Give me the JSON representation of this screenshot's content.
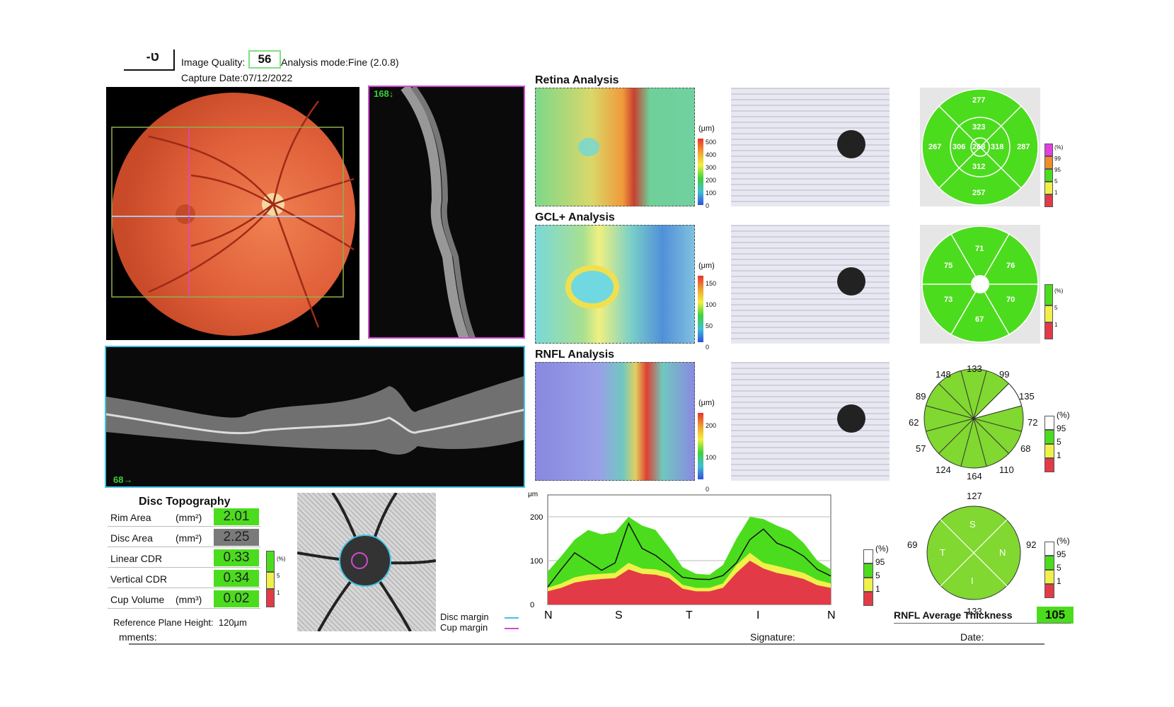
{
  "header": {
    "logo_fragment": "-ט",
    "image_quality_label": "Image Quality:",
    "image_quality_value": "56",
    "analysis_mode": "Analysis mode:Fine (2.0.8)",
    "capture_date": "Capture Date:07/12/2022"
  },
  "scans": {
    "vertical_oct_label": "168↓",
    "horizontal_oct_label": "68→"
  },
  "analysis": {
    "retina_title": "Retina Analysis",
    "gcl_title": "GCL+ Analysis",
    "rnfl_title": "RNFL Analysis",
    "unit": "(μm)",
    "retina_scale": [
      "500",
      "400",
      "300",
      "200",
      "100",
      "0"
    ],
    "gcl_scale": [
      "150",
      "100",
      "50",
      "0"
    ],
    "rnfl_scale": [
      "200",
      "100",
      "0"
    ]
  },
  "retina_grid": {
    "top": "277",
    "inner_top": "323",
    "left_outer": "267",
    "left_inner": "306",
    "center": "268",
    "right_inner": "318",
    "right_outer": "287",
    "inner_bottom": "312",
    "bottom": "257",
    "legend": [
      "(%)",
      "99",
      "95",
      "5",
      "1"
    ]
  },
  "gcl_sectors": {
    "top": "71",
    "upper_left": "75",
    "upper_right": "76",
    "lower_left": "73",
    "lower_right": "70",
    "bottom": "67",
    "legend": [
      "(%)",
      "5",
      "1"
    ]
  },
  "rnfl_clock": {
    "values": [
      "133",
      "99",
      "135",
      "72",
      "68",
      "110",
      "164",
      "124",
      "57",
      "62",
      "89",
      "148"
    ],
    "legend": [
      "(%)",
      "95",
      "5",
      "1"
    ]
  },
  "rnfl_quadrant": {
    "top": "127",
    "bottom": "133",
    "left": "69",
    "right": "92",
    "s": "S",
    "t": "T",
    "n": "N",
    "i": "I",
    "legend": [
      "(%)",
      "95",
      "5",
      "1"
    ]
  },
  "disc_topography": {
    "title": "Disc Topography",
    "rows": [
      {
        "label": "Rim Area",
        "unit": "(mm²)",
        "value": "2.01"
      },
      {
        "label": "Disc Area",
        "unit": "(mm²)",
        "value": "2.25"
      },
      {
        "label": "Linear CDR",
        "unit": "",
        "value": "0.33"
      },
      {
        "label": "Vertical CDR",
        "unit": "",
        "value": "0.34"
      },
      {
        "label": "Cup Volume",
        "unit": "(mm³)",
        "value": "0.02"
      }
    ],
    "reference_plane": "Reference Plane Height:  120μm",
    "legend": [
      "(%)",
      "5",
      "1"
    ],
    "disc_margin": "Disc margin",
    "cup_margin": "Cup margin"
  },
  "chart_data": {
    "type": "line",
    "ylabel": "μm",
    "ylim": [
      0,
      250
    ],
    "yticks": [
      "200",
      "100",
      "0"
    ],
    "xticks": [
      "N",
      "S",
      "T",
      "I",
      "N"
    ],
    "legend": [
      "(%)",
      "95",
      "5",
      "1"
    ],
    "series": [
      {
        "values": [
          40,
          80,
          118,
          98,
          78,
          95,
          185,
          128,
          112,
          88,
          62,
          58,
          57,
          66,
          95,
          148,
          172,
          140,
          128,
          110,
          80,
          65
        ]
      }
    ],
    "normative_95": [
      75,
      110,
      148,
      170,
      160,
      165,
      200,
      180,
      170,
      130,
      85,
      70,
      68,
      90,
      150,
      200,
      195,
      180,
      168,
      140,
      100,
      80
    ],
    "normative_5": [
      38,
      48,
      62,
      68,
      70,
      72,
      95,
      82,
      80,
      72,
      45,
      38,
      38,
      48,
      90,
      118,
      95,
      88,
      80,
      72,
      56,
      48
    ],
    "normative_1": [
      30,
      38,
      50,
      55,
      58,
      60,
      80,
      70,
      68,
      60,
      36,
      30,
      30,
      38,
      72,
      100,
      82,
      72,
      66,
      58,
      44,
      38
    ]
  },
  "footer": {
    "rnfl_avg_label": "RNFL Average Thickness",
    "rnfl_avg_value": "105",
    "comments": "mments:",
    "signature": "Signature:",
    "date": "Date:"
  },
  "colors": {
    "normal_green": "#4cdc1e",
    "borderline_yellow": "#f0f04a",
    "abnormal_red": "#e33a48",
    "top_magenta": "#e040e0",
    "orange": "#f08c2a"
  }
}
